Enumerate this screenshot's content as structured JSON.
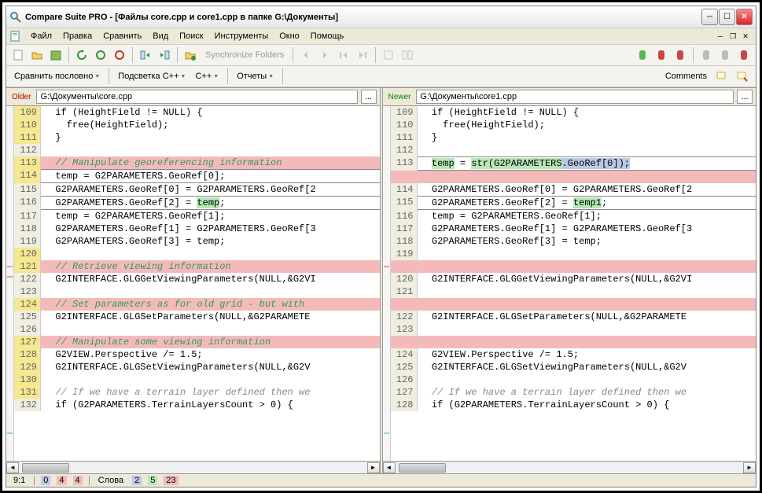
{
  "title": "Compare Suite PRO - [Файлы core.cpp и core1.cpp в папке G:\\Документы]",
  "menu": [
    "Файл",
    "Правка",
    "Сравнить",
    "Вид",
    "Поиск",
    "Инструменты",
    "Окно",
    "Помощь"
  ],
  "toolbar": {
    "sync_folders": "Synchronize Folders"
  },
  "toolbar2": {
    "compare_mode": "Сравнить пословно",
    "highlight": "Подсветка С++",
    "lang": "C++",
    "reports": "Отчеты",
    "comments": "Comments"
  },
  "left": {
    "label": "Older",
    "path": "G:\\Документы\\core.cpp",
    "lines": [
      {
        "n": 109,
        "t": "  if (HeightField != NULL) {",
        "ln": "mod",
        "row": "nrm"
      },
      {
        "n": 110,
        "t": "    free(HeightField);",
        "ln": "mod",
        "row": "nrm"
      },
      {
        "n": 111,
        "t": "  }",
        "ln": "mod",
        "row": "nrm"
      },
      {
        "n": 112,
        "t": "",
        "ln": "",
        "row": "nrm"
      },
      {
        "n": 113,
        "t": "  // Manipulate georeferencing information",
        "ln": "mod",
        "row": "del",
        "cls": "hl-comment"
      },
      {
        "n": 114,
        "t": "  temp = G2PARAMETERS.GeoRef[0];",
        "ln": "mod",
        "row": "mod"
      },
      {
        "n": 115,
        "t": "  G2PARAMETERS.GeoRef[0] = G2PARAMETERS.GeoRef[2",
        "ln": "",
        "row": "nrm"
      },
      {
        "n": 116,
        "t": "  G2PARAMETERS.GeoRef[2] = ",
        "tail": "temp",
        "tailcls": "hl-add",
        "ln": "",
        "row": "mod",
        "suffix": ";"
      },
      {
        "n": 117,
        "t": "  temp = G2PARAMETERS.GeoRef[1];",
        "ln": "",
        "row": "nrm"
      },
      {
        "n": 118,
        "t": "  G2PARAMETERS.GeoRef[1] = G2PARAMETERS.GeoRef[3",
        "ln": "",
        "row": "nrm"
      },
      {
        "n": 119,
        "t": "  G2PARAMETERS.GeoRef[3] = temp;",
        "ln": "",
        "row": "nrm"
      },
      {
        "n": 120,
        "t": "",
        "ln": "mod",
        "row": "nrm"
      },
      {
        "n": 121,
        "t": "  // Retrieve viewing information",
        "ln": "mod",
        "row": "del",
        "cls": "hl-comment"
      },
      {
        "n": 122,
        "t": "  G2INTERFACE.GLGGetViewingParameters(NULL,&G2VI",
        "ln": "",
        "row": "nrm"
      },
      {
        "n": 123,
        "t": "",
        "ln": "",
        "row": "nrm"
      },
      {
        "n": 124,
        "t": "  // Set parameters as for old grid - but with",
        "ln": "mod",
        "row": "del",
        "cls": "hl-comment"
      },
      {
        "n": 125,
        "t": "  G2INTERFACE.GLGSetParameters(NULL,&G2PARAMETE",
        "ln": "",
        "row": "nrm"
      },
      {
        "n": 126,
        "t": "",
        "ln": "",
        "row": "nrm"
      },
      {
        "n": 127,
        "t": "  // Manipulate some viewing information",
        "ln": "mod",
        "row": "del",
        "cls": "hl-comment"
      },
      {
        "n": 128,
        "t": "  G2VIEW.Perspective /= 1.5;",
        "ln": "mod",
        "row": "nrm"
      },
      {
        "n": 129,
        "t": "  G2INTERFACE.GLGSetViewingParameters(NULL,&G2V",
        "ln": "mod",
        "row": "nrm"
      },
      {
        "n": 130,
        "t": "",
        "ln": "mod",
        "row": "nrm"
      },
      {
        "n": 131,
        "t": "  // If we have a terrain layer defined then we",
        "ln": "mod",
        "row": "nrm",
        "cls": "cmt"
      },
      {
        "n": 132,
        "t": "  if (G2PARAMETERS.TerrainLayersCount > 0) {",
        "ln": "",
        "row": "nrm"
      }
    ]
  },
  "right": {
    "label": "Newer",
    "path": "G:\\Документы\\core1.cpp",
    "lines": [
      {
        "n": 109,
        "t": "  if (HeightField != NULL) {",
        "ln": "",
        "row": "nrm"
      },
      {
        "n": 110,
        "t": "    free(HeightField);",
        "ln": "",
        "row": "nrm"
      },
      {
        "n": 111,
        "t": "  }",
        "ln": "",
        "row": "nrm"
      },
      {
        "n": 112,
        "t": "",
        "ln": "",
        "row": "nrm"
      },
      {
        "n": 113,
        "t": "  ",
        "pre": "temp",
        "precls": "hl-add",
        "mid": " = ",
        "mid2": "str(G2PARAMETERS",
        "mid2cls": "hl-add",
        "post": ".GeoRef[0]",
        "postcls": "hl-sel",
        "end": ");",
        "endcls": "hl-sel",
        "ln": "",
        "row": "mod"
      },
      {
        "n": "",
        "t": "",
        "ln": "",
        "row": "del",
        "gap": true
      },
      {
        "n": 114,
        "t": "  G2PARAMETERS.GeoRef[0] = G2PARAMETERS.GeoRef[2",
        "ln": "",
        "row": "nrm"
      },
      {
        "n": 115,
        "t": "  G2PARAMETERS.GeoRef[2] = ",
        "tail": "temp1",
        "tailcls": "hl-add",
        "suffix": ";",
        "ln": "",
        "row": "mod"
      },
      {
        "n": 116,
        "t": "  temp = G2PARAMETERS.GeoRef[1];",
        "ln": "",
        "row": "nrm"
      },
      {
        "n": 117,
        "t": "  G2PARAMETERS.GeoRef[1] = G2PARAMETERS.GeoRef[3",
        "ln": "",
        "row": "nrm"
      },
      {
        "n": 118,
        "t": "  G2PARAMETERS.GeoRef[3] = temp;",
        "ln": "",
        "row": "nrm"
      },
      {
        "n": 119,
        "t": "",
        "ln": "",
        "row": "nrm"
      },
      {
        "n": "",
        "t": "",
        "ln": "",
        "row": "del",
        "gap": true
      },
      {
        "n": 120,
        "t": "  G2INTERFACE.GLGGetViewingParameters(NULL,&G2VI",
        "ln": "",
        "row": "nrm"
      },
      {
        "n": 121,
        "t": "",
        "ln": "",
        "row": "nrm"
      },
      {
        "n": "",
        "t": "",
        "ln": "",
        "row": "del",
        "gap": true
      },
      {
        "n": 122,
        "t": "  G2INTERFACE.GLGSetParameters(NULL,&G2PARAMETE",
        "ln": "",
        "row": "nrm"
      },
      {
        "n": 123,
        "t": "",
        "ln": "",
        "row": "nrm"
      },
      {
        "n": "",
        "t": "",
        "ln": "",
        "row": "del",
        "gap": true
      },
      {
        "n": 124,
        "t": "  G2VIEW.Perspective /= 1.5;",
        "ln": "",
        "row": "nrm"
      },
      {
        "n": 125,
        "t": "  G2INTERFACE.GLGSetViewingParameters(NULL,&G2V",
        "ln": "",
        "row": "nrm"
      },
      {
        "n": 126,
        "t": "",
        "ln": "",
        "row": "nrm"
      },
      {
        "n": 127,
        "t": "  // If we have a terrain layer defined then we",
        "ln": "",
        "row": "nrm",
        "cls": "cmt"
      },
      {
        "n": 128,
        "t": "  if (G2PARAMETERS.TerrainLayersCount > 0) {",
        "ln": "",
        "row": "nrm"
      }
    ]
  },
  "status": {
    "pos": "9:1",
    "diff_del": "0",
    "diff_mod": "4",
    "diff_add": "4",
    "words_lbl": "Слова",
    "w1": "2",
    "w2": "5",
    "w3": "23"
  }
}
